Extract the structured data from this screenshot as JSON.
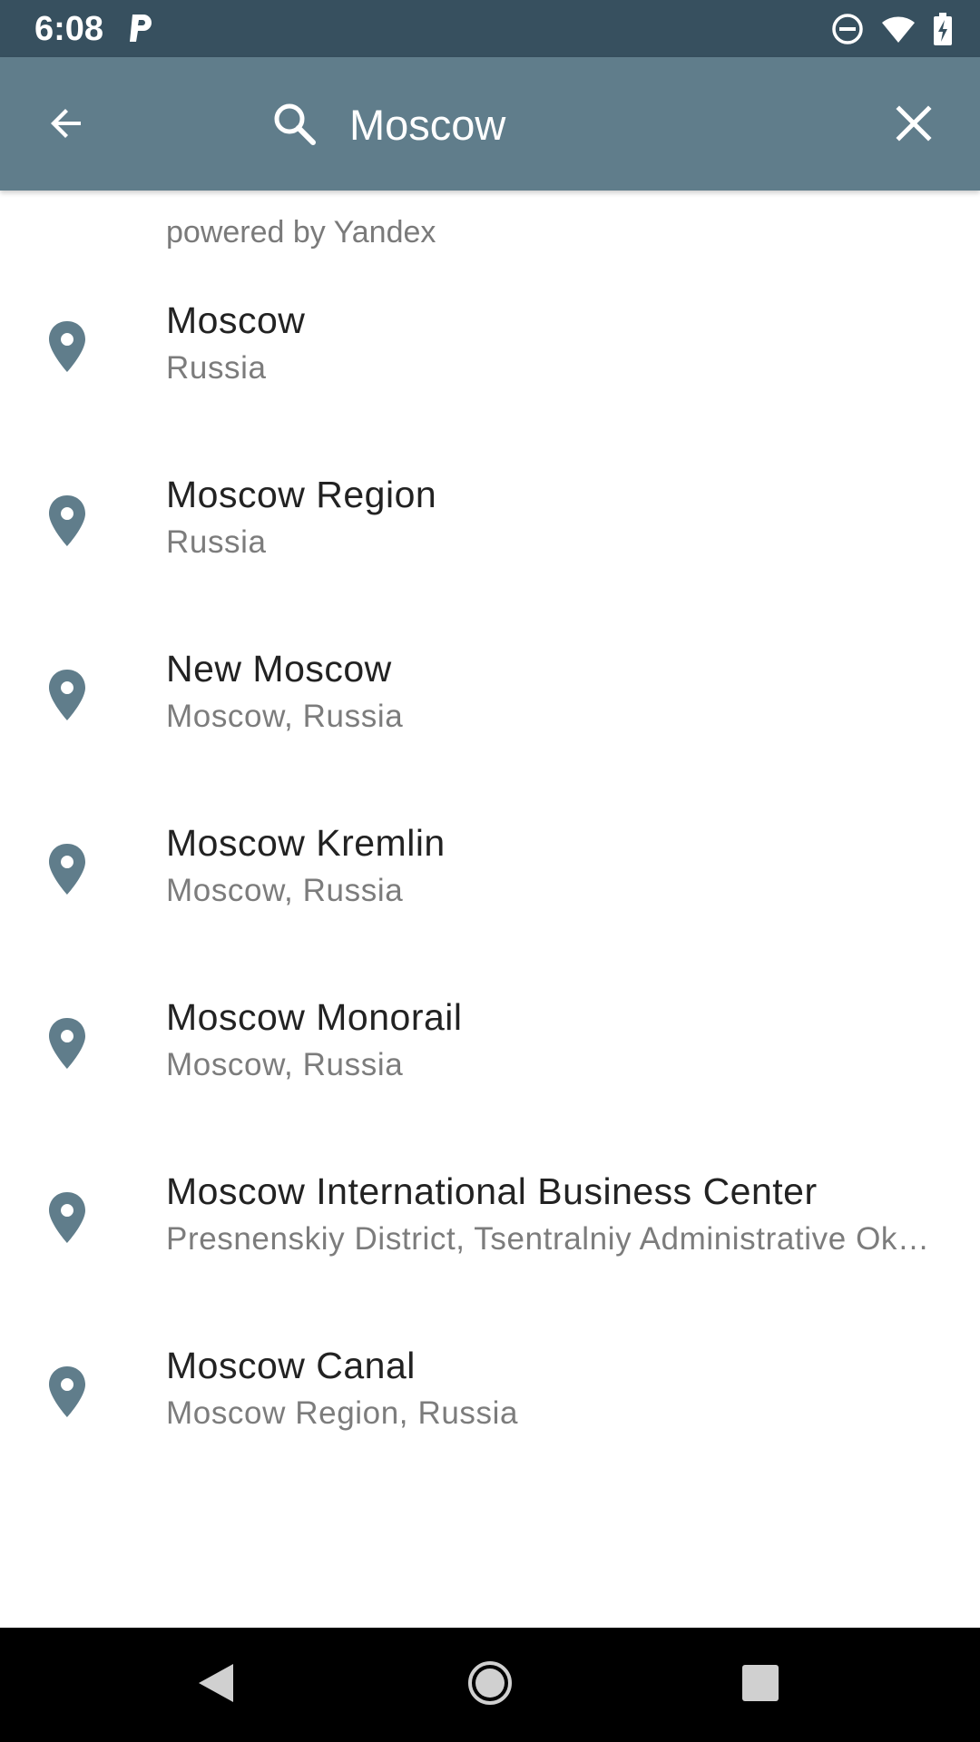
{
  "status_bar": {
    "time": "6:08",
    "icons": [
      "parking-app-icon",
      "do-not-disturb-icon",
      "wifi-icon",
      "battery-charging-icon"
    ]
  },
  "app_bar": {
    "search_value": "Moscow",
    "icons": [
      "back-arrow-icon",
      "search-icon",
      "close-icon"
    ]
  },
  "attribution": "powered by Yandex",
  "results": [
    {
      "title": "Moscow",
      "subtitle": "Russia"
    },
    {
      "title": "Moscow Region",
      "subtitle": "Russia"
    },
    {
      "title": "New Moscow",
      "subtitle": "Moscow, Russia"
    },
    {
      "title": "Moscow Kremlin",
      "subtitle": "Moscow, Russia"
    },
    {
      "title": "Moscow Monorail",
      "subtitle": "Moscow, Russia"
    },
    {
      "title": "Moscow International Business Center",
      "subtitle": "Presnenskiy District, Tsentralniy Administrative Okrug, Moscow, Russia"
    },
    {
      "title": "Moscow Canal",
      "subtitle": "Moscow Region, Russia"
    }
  ],
  "colors": {
    "status_bar": "#37505f",
    "app_bar": "#607d8b",
    "pin": "#607d8b",
    "nav_bar": "#000000"
  },
  "nav_bar": {
    "icons": [
      "nav-back-icon",
      "nav-home-icon",
      "nav-recents-icon"
    ]
  }
}
